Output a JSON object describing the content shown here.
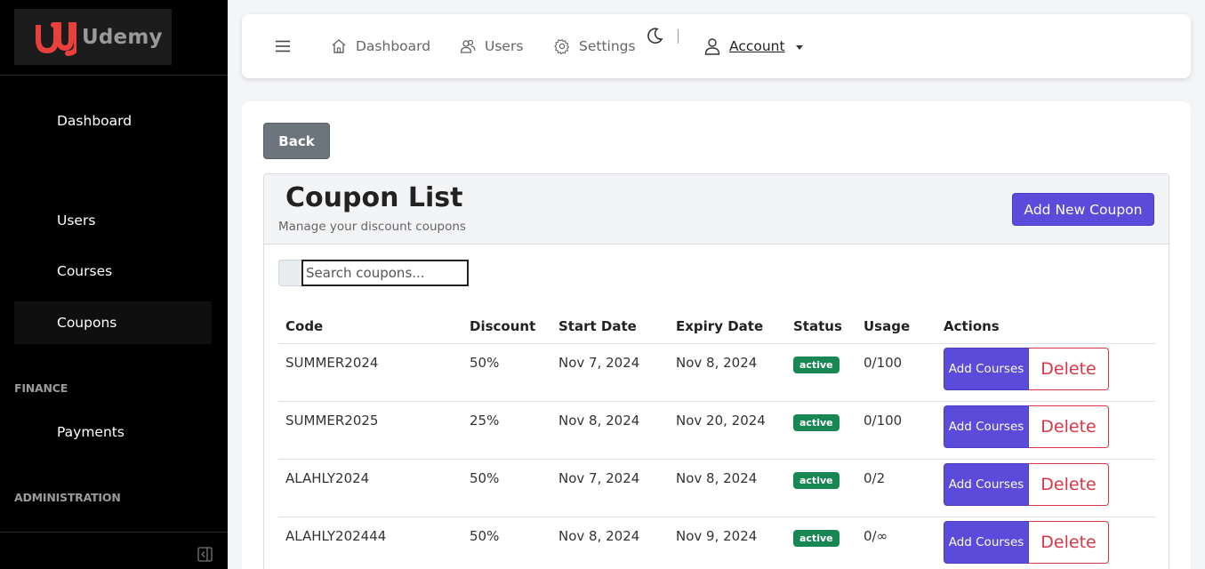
{
  "brand": {
    "name": "Udemy",
    "logo_icon": "udemy-u-logo"
  },
  "sidebar": {
    "items": [
      {
        "label": "Dashboard"
      },
      {
        "label": "Users"
      },
      {
        "label": "Courses"
      },
      {
        "label": "Coupons",
        "active": true
      },
      {
        "label": "Payments"
      }
    ],
    "sections": {
      "finance": "FINANCE",
      "administration": "ADMINISTRATION"
    },
    "collapse_icon": "collapse-sidebar-icon"
  },
  "topbar": {
    "menu_icon": "hamburger-icon",
    "dashboard": {
      "label": "Dashboard",
      "icon": "home-icon"
    },
    "users": {
      "label": "Users",
      "icon": "users-icon"
    },
    "settings": {
      "label": "Settings",
      "icon": "gear-icon"
    },
    "theme_icon": "moon-icon",
    "account": {
      "label": "Account",
      "icon": "user-icon"
    }
  },
  "main": {
    "back_label": "Back",
    "title": "Coupon List",
    "subtitle": "Manage your discount coupons",
    "add_label": "Add New Coupon",
    "search": {
      "placeholder": "Search coupons...",
      "value": ""
    },
    "table": {
      "headers": [
        "Code",
        "Discount",
        "Start Date",
        "Expiry Date",
        "Status",
        "Usage",
        "Actions"
      ],
      "rows": [
        {
          "code": "SUMMER2024",
          "discount": "50%",
          "start": "Nov 7, 2024",
          "expiry": "Nov 8, 2024",
          "status": "active",
          "usage": "0/100"
        },
        {
          "code": "SUMMER2025",
          "discount": "25%",
          "start": "Nov 8, 2024",
          "expiry": "Nov 20, 2024",
          "status": "active",
          "usage": "0/100"
        },
        {
          "code": "ALAHLY2024",
          "discount": "50%",
          "start": "Nov 7, 2024",
          "expiry": "Nov 8, 2024",
          "status": "active",
          "usage": "0/2"
        },
        {
          "code": "ALAHLY202444",
          "discount": "50%",
          "start": "Nov 8, 2024",
          "expiry": "Nov 9, 2024",
          "status": "active",
          "usage": "0/∞"
        }
      ],
      "add_courses_label": "Add Courses",
      "delete_label": "Delete"
    }
  },
  "colors": {
    "primary": "#5b4bdb",
    "secondary": "#6c757d",
    "danger": "#dc3545",
    "success": "#198754",
    "sidebar_bg": "#000000",
    "logo_accent": "#e8413d"
  }
}
